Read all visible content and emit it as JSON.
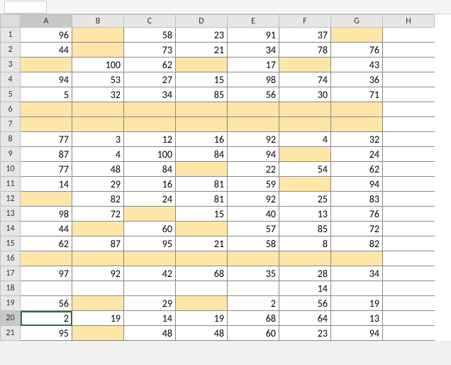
{
  "chart_data": {
    "type": "table",
    "columns": [
      "A",
      "B",
      "C",
      "D",
      "E",
      "F",
      "G"
    ],
    "rows": [
      1,
      2,
      3,
      4,
      5,
      6,
      7,
      8,
      9,
      10,
      11,
      12,
      13,
      14,
      15,
      16,
      17,
      18,
      19,
      20,
      21
    ],
    "highlight_color": "#ffe6a8",
    "cells": [
      [
        {
          "v": 96
        },
        {
          "v": null,
          "h": true
        },
        {
          "v": 58
        },
        {
          "v": 23
        },
        {
          "v": 91
        },
        {
          "v": 37
        },
        {
          "v": null,
          "h": true
        }
      ],
      [
        {
          "v": 44
        },
        {
          "v": null,
          "h": true
        },
        {
          "v": 73
        },
        {
          "v": 21
        },
        {
          "v": 34
        },
        {
          "v": 78
        },
        {
          "v": 76
        }
      ],
      [
        {
          "v": null,
          "h": true
        },
        {
          "v": 100
        },
        {
          "v": 62
        },
        {
          "v": null,
          "h": true
        },
        {
          "v": 17
        },
        {
          "v": null,
          "h": true
        },
        {
          "v": 43
        }
      ],
      [
        {
          "v": 94
        },
        {
          "v": 53
        },
        {
          "v": 27
        },
        {
          "v": 15
        },
        {
          "v": 98
        },
        {
          "v": 74
        },
        {
          "v": 36
        }
      ],
      [
        {
          "v": 5
        },
        {
          "v": 32
        },
        {
          "v": 34
        },
        {
          "v": 85
        },
        {
          "v": 56
        },
        {
          "v": 30
        },
        {
          "v": 71
        }
      ],
      [
        {
          "v": null,
          "h": true
        },
        {
          "v": null,
          "h": true
        },
        {
          "v": null,
          "h": true
        },
        {
          "v": null,
          "h": true
        },
        {
          "v": null,
          "h": true
        },
        {
          "v": null,
          "h": true
        },
        {
          "v": null,
          "h": true
        }
      ],
      [
        {
          "v": null,
          "h": true
        },
        {
          "v": null,
          "h": true
        },
        {
          "v": null,
          "h": true
        },
        {
          "v": null,
          "h": true
        },
        {
          "v": null,
          "h": true
        },
        {
          "v": null,
          "h": true
        },
        {
          "v": null,
          "h": true
        }
      ],
      [
        {
          "v": 77
        },
        {
          "v": 3
        },
        {
          "v": 12
        },
        {
          "v": 16
        },
        {
          "v": 92
        },
        {
          "v": 4
        },
        {
          "v": 32
        }
      ],
      [
        {
          "v": 87
        },
        {
          "v": 4
        },
        {
          "v": 100
        },
        {
          "v": 84
        },
        {
          "v": 94
        },
        {
          "v": null,
          "h": true
        },
        {
          "v": 24
        }
      ],
      [
        {
          "v": 77
        },
        {
          "v": 48
        },
        {
          "v": 84
        },
        {
          "v": null,
          "h": true
        },
        {
          "v": 22
        },
        {
          "v": 54
        },
        {
          "v": 62
        }
      ],
      [
        {
          "v": 14
        },
        {
          "v": 29
        },
        {
          "v": 16
        },
        {
          "v": 81
        },
        {
          "v": 59
        },
        {
          "v": null,
          "h": true
        },
        {
          "v": 94
        }
      ],
      [
        {
          "v": null,
          "h": true
        },
        {
          "v": 82
        },
        {
          "v": 24
        },
        {
          "v": 81
        },
        {
          "v": 92
        },
        {
          "v": 25
        },
        {
          "v": 83
        }
      ],
      [
        {
          "v": 98
        },
        {
          "v": 72
        },
        {
          "v": null,
          "h": true
        },
        {
          "v": 15
        },
        {
          "v": 40
        },
        {
          "v": 13
        },
        {
          "v": 76
        }
      ],
      [
        {
          "v": 44
        },
        {
          "v": null,
          "h": true
        },
        {
          "v": 60
        },
        {
          "v": null,
          "h": true
        },
        {
          "v": 57
        },
        {
          "v": 85
        },
        {
          "v": 72
        }
      ],
      [
        {
          "v": 62
        },
        {
          "v": 87
        },
        {
          "v": 95
        },
        {
          "v": 21
        },
        {
          "v": 58
        },
        {
          "v": 8
        },
        {
          "v": 82
        }
      ],
      [
        {
          "v": null,
          "h": true
        },
        {
          "v": null,
          "h": true
        },
        {
          "v": null,
          "h": true
        },
        {
          "v": null,
          "h": true
        },
        {
          "v": null,
          "h": true
        },
        {
          "v": null,
          "h": true
        },
        {
          "v": null,
          "h": true
        }
      ],
      [
        {
          "v": 97
        },
        {
          "v": 92
        },
        {
          "v": 42
        },
        {
          "v": 68
        },
        {
          "v": 35
        },
        {
          "v": 28
        },
        {
          "v": 34
        }
      ],
      [
        {
          "v": null
        },
        {
          "v": null
        },
        {
          "v": null
        },
        {
          "v": null
        },
        {
          "v": null
        },
        {
          "v": 14
        },
        {
          "v": null
        }
      ],
      [
        {
          "v": 56
        },
        {
          "v": null,
          "h": true
        },
        {
          "v": 29
        },
        {
          "v": null,
          "h": true
        },
        {
          "v": 2
        },
        {
          "v": 56
        },
        {
          "v": 19
        }
      ],
      [
        {
          "v": 2
        },
        {
          "v": 19
        },
        {
          "v": 14
        },
        {
          "v": 19
        },
        {
          "v": 68
        },
        {
          "v": 64
        },
        {
          "v": 13
        }
      ],
      [
        {
          "v": 95
        },
        {
          "v": null,
          "h": true
        },
        {
          "v": 48
        },
        {
          "v": 48
        },
        {
          "v": 60
        },
        {
          "v": 23
        },
        {
          "v": 94
        }
      ]
    ]
  },
  "columns": [
    "A",
    "B",
    "C",
    "D",
    "E",
    "F",
    "G",
    "H"
  ],
  "active_cell": {
    "row": 20,
    "col": "A"
  },
  "name_box": ""
}
